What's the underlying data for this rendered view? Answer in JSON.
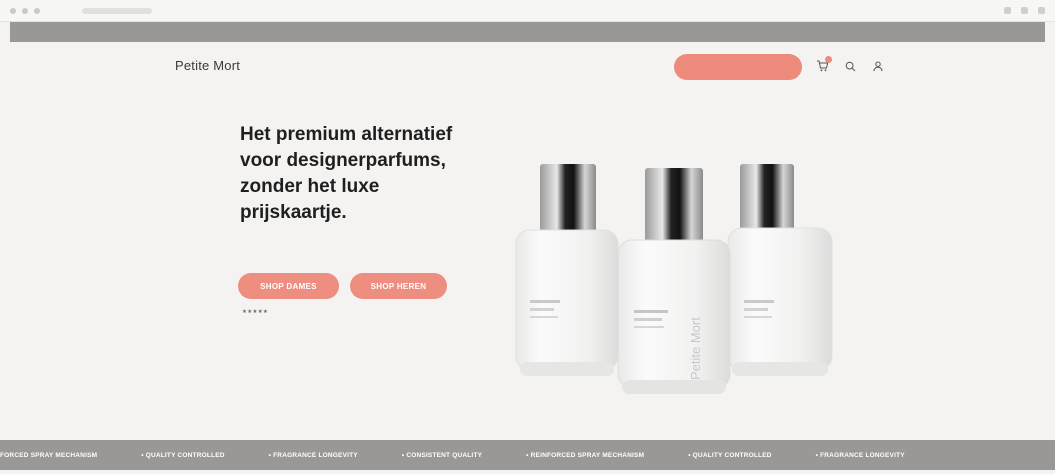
{
  "announcement": "",
  "header": {
    "logo": "Petite Mort",
    "nav": [],
    "cta": "",
    "icons": [
      "cart-icon",
      "search-icon",
      "account-icon"
    ]
  },
  "hero": {
    "title": "Het premium alternatief voor designerparfums, zonder het luxe prijskaartje.",
    "subtitle": "",
    "buttons": [
      "SHOP DAMES",
      "SHOP HEREN"
    ],
    "rating_text": "",
    "usps": []
  },
  "product": {
    "brand_on_bottle": "Petite Mort"
  },
  "ticker": [
    "FORCED SPRAY MECHANISM",
    "QUALITY CONTROLLED",
    "FRAGRANCE LONGEVITY",
    "CONSISTENT QUALITY",
    "REINFORCED SPRAY MECHANISM",
    "QUALITY CONTROLLED",
    "FRAGRANCE LONGEVITY"
  ],
  "colors": {
    "accent": "#ee8a7c",
    "bar": "#9a9896",
    "background": "#f4f3f1"
  }
}
